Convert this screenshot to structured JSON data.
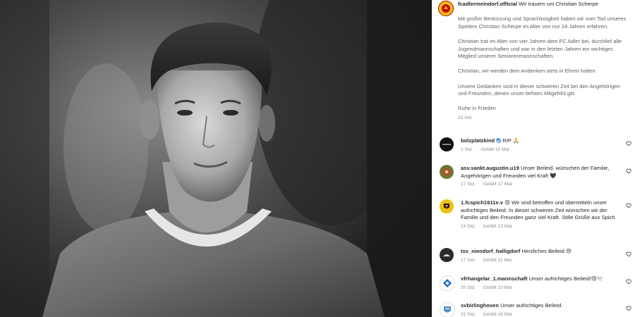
{
  "post": {
    "author": "fcadlermeindorf.official",
    "title": "Wir trauern um Christian Scherpe",
    "paragraphs": [
      "Mit großer Bestürzung und Sprachlosigkeit haben wir vom Tod unseres Spielers Christian Scherpe im Alter von nur 24 Jahren erfahren.",
      "Christian trat im Alter von vier Jahren dem FC Adler bei, durchlief alle Jugendmannschaften und war in den letzten Jahren ein wichtiges Mitglied unserer Seniorenmannschaften.",
      "Christian, wir werden dein Andenken stets in Ehren halten.",
      "Unsere Gedanken sind in dieser schweren Zeit bei den Angehörigen und Freunden, denen unser tiefstes Mitgefühl gilt.",
      "Ruhe in Frieden"
    ],
    "time": "23 Std."
  },
  "comments": [
    {
      "user": "bolzplatzkind",
      "verified": true,
      "text": "RIP 🙏",
      "time": "1 Std.",
      "likes": "Gefällt 10 Mal",
      "avatar_color": "#111111"
    },
    {
      "user": "asv.sankt.augustin.u19",
      "verified": false,
      "text": "Unser Beileid, wünschen der Familie, Angehörigen und Freunden viel Kraft 🖤",
      "time": "17 Std.",
      "likes": "Gefällt 17 Mal",
      "avatar_color": "#6b7a2a"
    },
    {
      "user": "1.fcspich1911e.v",
      "verified": false,
      "text": "😢 Wir sind betroffen und übermitteln unser aufrichtiges Beileid. In dieser schweren Zeit wünschen wir der Familie und den Freunden ganz viel Kraft. Stille Grüße aus Spich",
      "time": "14 Std.",
      "likes": "Gefällt 13 Mal",
      "avatar_color": "#f2c200"
    },
    {
      "user": "tsv_niendorf_halligdorf",
      "verified": false,
      "text": "Herzliches Beileid 😢",
      "time": "17 Std.",
      "likes": "Gefällt 11 Mal",
      "avatar_color": "#2b2b2b"
    },
    {
      "user": "vfrhangelar_1.mannschaft",
      "verified": false,
      "text": "Unser aufrichtiges Beileid!😢🕊️",
      "time": "20 Std.",
      "likes": "Gefällt 10 Mal",
      "avatar_color": "#1c6fd1"
    },
    {
      "user": "svbirlinghoven",
      "verified": false,
      "text": "Unser aufrichtiges Beileid.",
      "time": "22 Std.",
      "likes": "Gefällt 16 Mal",
      "avatar_color": "#4a8fd0"
    }
  ]
}
